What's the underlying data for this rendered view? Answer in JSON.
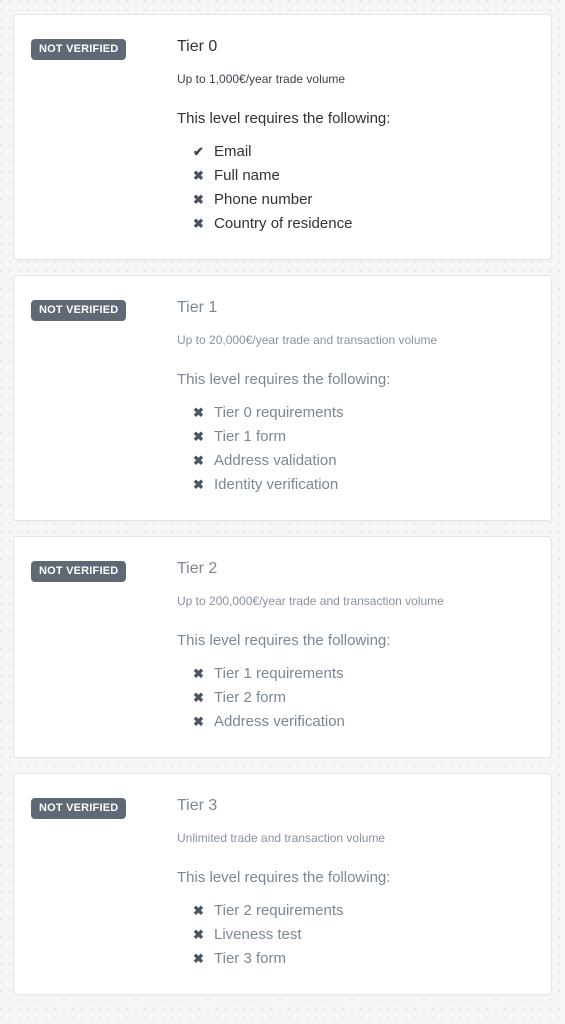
{
  "page": {
    "background_color": "#f5f6f7",
    "card_background": "#ffffff",
    "card_border_color": "#e3e6e9",
    "badge_color": "#5f6874",
    "muted_text_color": "#7b8794",
    "active_text_color": "#2e3338"
  },
  "requires_label": "This level requires the following:",
  "tiers": [
    {
      "status_badge": "NOT VERIFIED",
      "title": "Tier 0",
      "subtitle": "Up to 1,000€/year trade volume",
      "requires_label": "This level requires the following:",
      "is_current": true,
      "requirements": [
        {
          "label": "Email",
          "state": "done",
          "icon": "check-icon",
          "glyph": "✔"
        },
        {
          "label": "Full name",
          "state": "pending",
          "icon": "cross-icon",
          "glyph": "✖"
        },
        {
          "label": "Phone number",
          "state": "pending",
          "icon": "cross-icon",
          "glyph": "✖"
        },
        {
          "label": "Country of residence",
          "state": "pending",
          "icon": "cross-icon",
          "glyph": "✖"
        }
      ]
    },
    {
      "status_badge": "NOT VERIFIED",
      "title": "Tier 1",
      "subtitle": "Up to 20,000€/year trade and transaction volume",
      "requires_label": "This level requires the following:",
      "is_current": false,
      "requirements": [
        {
          "label": "Tier 0 requirements",
          "state": "pending",
          "icon": "cross-icon",
          "glyph": "✖"
        },
        {
          "label": "Tier 1 form",
          "state": "pending",
          "icon": "cross-icon",
          "glyph": "✖"
        },
        {
          "label": "Address validation",
          "state": "pending",
          "icon": "cross-icon",
          "glyph": "✖"
        },
        {
          "label": "Identity verification",
          "state": "pending",
          "icon": "cross-icon",
          "glyph": "✖"
        }
      ]
    },
    {
      "status_badge": "NOT VERIFIED",
      "title": "Tier 2",
      "subtitle": "Up to 200,000€/year trade and transaction volume",
      "requires_label": "This level requires the following:",
      "is_current": false,
      "requirements": [
        {
          "label": "Tier 1 requirements",
          "state": "pending",
          "icon": "cross-icon",
          "glyph": "✖"
        },
        {
          "label": "Tier 2 form",
          "state": "pending",
          "icon": "cross-icon",
          "glyph": "✖"
        },
        {
          "label": "Address verification",
          "state": "pending",
          "icon": "cross-icon",
          "glyph": "✖"
        }
      ]
    },
    {
      "status_badge": "NOT VERIFIED",
      "title": "Tier 3",
      "subtitle": "Unlimited trade and transaction volume",
      "requires_label": "This level requires the following:",
      "is_current": false,
      "requirements": [
        {
          "label": "Tier 2 requirements",
          "state": "pending",
          "icon": "cross-icon",
          "glyph": "✖"
        },
        {
          "label": "Liveness test",
          "state": "pending",
          "icon": "cross-icon",
          "glyph": "✖"
        },
        {
          "label": "Tier 3 form",
          "state": "pending",
          "icon": "cross-icon",
          "glyph": "✖"
        }
      ]
    }
  ]
}
